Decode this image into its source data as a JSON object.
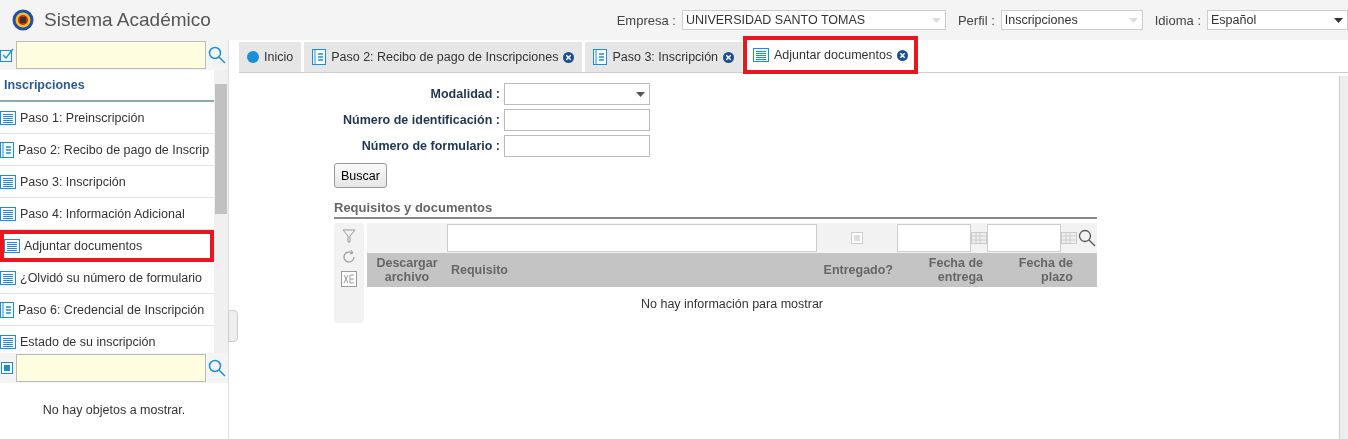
{
  "header": {
    "title": "Sistema Académico",
    "selectors": [
      {
        "label": "Empresa :",
        "value": "UNIVERSIDAD SANTO TOMAS",
        "disabled": true
      },
      {
        "label": "Perfil :",
        "value": "Inscripciones",
        "disabled": true
      },
      {
        "label": "Idioma :",
        "value": "Español",
        "disabled": false
      }
    ]
  },
  "sidebar": {
    "section": "Inscripciones",
    "items": [
      {
        "label": "Paso 1: Preinscripción",
        "kind": "list",
        "highlighted": false
      },
      {
        "label": "Paso 2: Recibo de pago de Inscrip",
        "kind": "form",
        "highlighted": false
      },
      {
        "label": "Paso 3: Inscripción",
        "kind": "list",
        "highlighted": false
      },
      {
        "label": "Paso 4: Información Adicional",
        "kind": "list",
        "highlighted": false
      },
      {
        "label": "Adjuntar documentos",
        "kind": "list",
        "highlighted": true
      },
      {
        "label": "¿Olvidó su número de formulario",
        "kind": "list",
        "highlighted": false
      },
      {
        "label": "Paso 6: Credencial de Inscripción",
        "kind": "form",
        "highlighted": false
      },
      {
        "label": "Estado de su inscripción",
        "kind": "list",
        "highlighted": false
      }
    ],
    "empty_message": "No hay objetos a mostrar."
  },
  "tabs": [
    {
      "label": "Inicio",
      "kind": "dot",
      "selected": false,
      "closable": false,
      "highlighted": false
    },
    {
      "label": "Paso 2: Recibo de pago de Inscripciones",
      "kind": "form",
      "selected": false,
      "closable": true,
      "highlighted": false
    },
    {
      "label": "Paso 3: Inscripción",
      "kind": "form",
      "selected": false,
      "closable": true,
      "highlighted": false
    },
    {
      "label": "Adjuntar documentos",
      "kind": "list",
      "selected": true,
      "closable": true,
      "highlighted": true
    }
  ],
  "form": {
    "fields": [
      {
        "label": "Modalidad :",
        "kind": "select"
      },
      {
        "label": "Número de identificación :",
        "kind": "text"
      },
      {
        "label": "Número de formulario :",
        "kind": "text"
      }
    ],
    "button": "Buscar"
  },
  "table": {
    "title": "Requisitos y documentos",
    "columns": [
      {
        "label": "Descargar archivo",
        "kind": "plain"
      },
      {
        "label": "Requisito",
        "kind": "text"
      },
      {
        "label": "Entregado?",
        "kind": "check"
      },
      {
        "label": "Fecha de entrega",
        "kind": "date"
      },
      {
        "label": "Fecha de plazo",
        "kind": "date"
      }
    ],
    "empty_message": "No hay información para mostrar"
  }
}
